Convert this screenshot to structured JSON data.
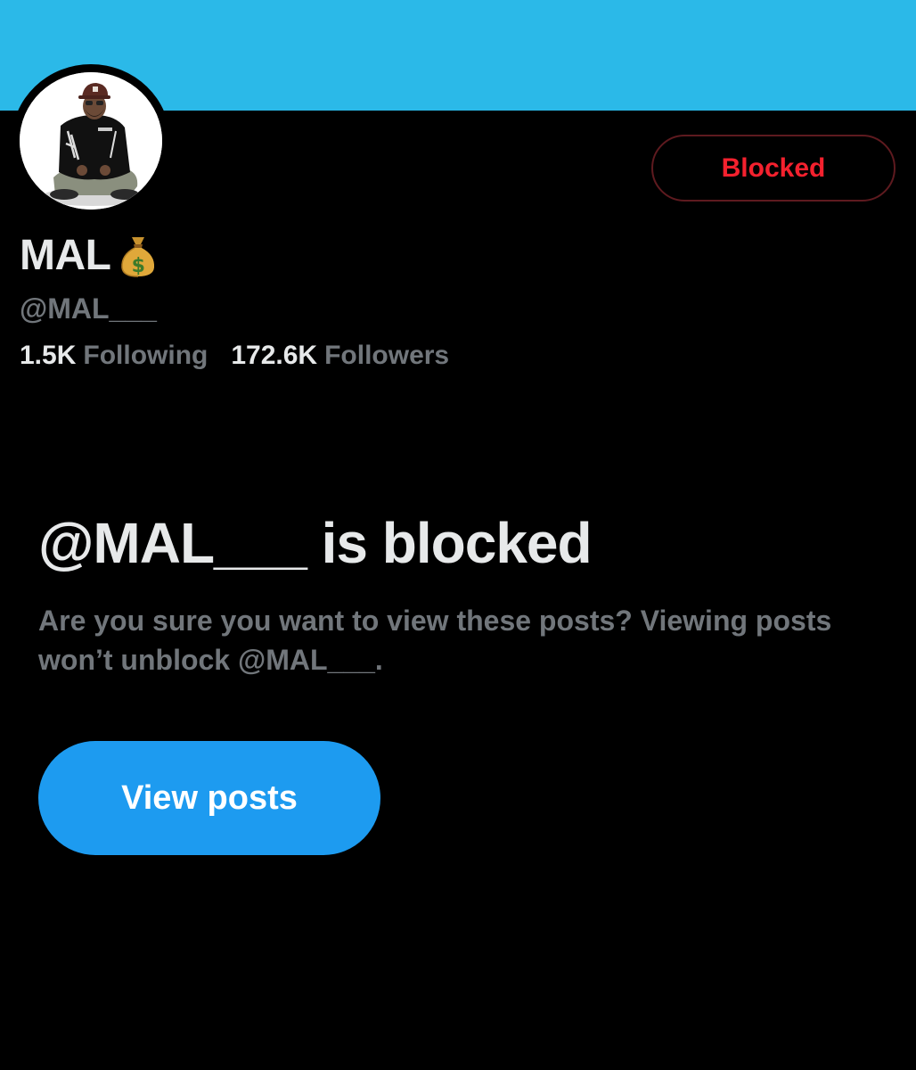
{
  "profile": {
    "display_name": "MAL",
    "name_emoji_icon": "money-bag-icon",
    "handle": "@MAL___",
    "following_count": "1.5K",
    "following_label": "Following",
    "followers_count": "172.6K",
    "followers_label": "Followers",
    "banner_color": "#2bb9e8"
  },
  "block_status": {
    "button_label": "Blocked",
    "button_color": "#f4212e"
  },
  "blocked_notice": {
    "title": "@MAL___ is blocked",
    "message": "Are you sure you want to view these posts? Viewing posts won’t unblock @MAL___.",
    "view_button_label": "View posts",
    "view_button_color": "#1d9bf0"
  }
}
